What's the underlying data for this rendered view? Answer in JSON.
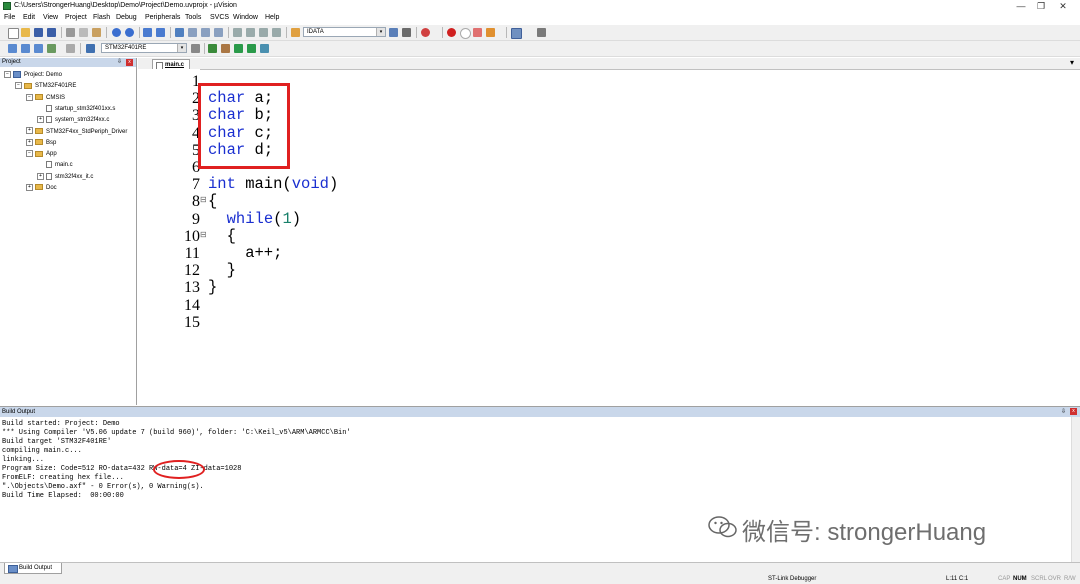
{
  "window": {
    "title": "C:\\Users\\StrongerHuang\\Desktop\\Demo\\Project\\Demo.uvprojx - µVision",
    "controls": [
      "—",
      "❐",
      "✕"
    ]
  },
  "menu": [
    "File",
    "Edit",
    "View",
    "Project",
    "Flash",
    "Debug",
    "Peripherals",
    "Tools",
    "SVCS",
    "Window",
    "Help"
  ],
  "toolbar1": {
    "search_value": "IDATA"
  },
  "toolbar2": {
    "target_value": "STM32F401RE"
  },
  "project_panel": {
    "header": "Project",
    "tree": [
      {
        "label": "Project: Demo",
        "depth": 0,
        "kind": "project",
        "toggle": "⊟"
      },
      {
        "label": "STM32F401RE",
        "depth": 1,
        "kind": "target",
        "toggle": "⊟"
      },
      {
        "label": "CMSIS",
        "depth": 2,
        "kind": "folder",
        "toggle": "⊟"
      },
      {
        "label": "startup_stm32f401xx.s",
        "depth": 3,
        "kind": "file",
        "toggle": ""
      },
      {
        "label": "system_stm32f4xx.c",
        "depth": 3,
        "kind": "file",
        "toggle": "⊞"
      },
      {
        "label": "STM32F4xx_StdPeriph_Driver",
        "depth": 2,
        "kind": "folder",
        "toggle": "⊞"
      },
      {
        "label": "Bsp",
        "depth": 2,
        "kind": "folder",
        "toggle": "⊞"
      },
      {
        "label": "App",
        "depth": 2,
        "kind": "folder",
        "toggle": "⊟"
      },
      {
        "label": "main.c",
        "depth": 3,
        "kind": "file",
        "toggle": ""
      },
      {
        "label": "stm32f4xx_it.c",
        "depth": 3,
        "kind": "file",
        "toggle": "⊞"
      },
      {
        "label": "Doc",
        "depth": 2,
        "kind": "folder",
        "toggle": "⊞"
      }
    ]
  },
  "editor": {
    "tab_label": "main.c",
    "line_numbers": [
      "1",
      "2",
      "3",
      "4",
      "5",
      "6",
      "7",
      "8",
      "9",
      "10",
      "11",
      "12",
      "13",
      "14",
      "15"
    ],
    "lines": [
      [],
      [
        {
          "t": "char",
          "c": "kw"
        },
        {
          "t": " a;",
          "c": ""
        }
      ],
      [
        {
          "t": "char",
          "c": "kw"
        },
        {
          "t": " b;",
          "c": ""
        }
      ],
      [
        {
          "t": "char",
          "c": "kw"
        },
        {
          "t": " c;",
          "c": ""
        }
      ],
      [
        {
          "t": "char",
          "c": "kw"
        },
        {
          "t": " d;",
          "c": ""
        }
      ],
      [],
      [
        {
          "t": "int",
          "c": "kw"
        },
        {
          "t": " main(",
          "c": ""
        },
        {
          "t": "void",
          "c": "kw"
        },
        {
          "t": ")",
          "c": ""
        }
      ],
      [
        {
          "t": "{",
          "c": ""
        }
      ],
      [
        {
          "t": "  ",
          "c": ""
        },
        {
          "t": "while",
          "c": "kw"
        },
        {
          "t": "(",
          "c": ""
        },
        {
          "t": "1",
          "c": "num"
        },
        {
          "t": ")",
          "c": ""
        }
      ],
      [
        {
          "t": "  {",
          "c": ""
        }
      ],
      [
        {
          "t": "    a++;",
          "c": ""
        }
      ],
      [
        {
          "t": "  }",
          "c": ""
        }
      ],
      [
        {
          "t": "}",
          "c": ""
        }
      ],
      [],
      []
    ],
    "fold_markers": [
      "⊟",
      "⊟"
    ]
  },
  "build_output": {
    "header": "Build Output",
    "lines": [
      "Build started: Project: Demo",
      "*** Using Compiler 'V5.06 update 7 (build 960)', folder: 'C:\\Keil_v5\\ARM\\ARMCC\\Bin'",
      "Build target 'STM32F401RE'",
      "compiling main.c...",
      "linking...",
      "Program Size: Code=512 RO-data=432 RW-data=4 ZI-data=1028",
      "FromELF: creating hex file...",
      "\".\\Objects\\Demo.axf\" - 0 Error(s), 0 Warning(s).",
      "Build Time Elapsed:  00:00:00"
    ]
  },
  "bottom_tab": "Build Output",
  "status_bar": {
    "debugger": "ST-Link Debugger",
    "position": "L:11 C:1",
    "caps": "CAP",
    "num": "NUM",
    "scrl": "SCRL",
    "ovr": "OVR",
    "rw": "R/W"
  },
  "watermark": {
    "text": "微信号: strongerHuang"
  },
  "colors": {
    "keyword": "#1a2fd0",
    "number": "#18806a",
    "annotation_red": "#e02020",
    "panel_header": "#c9d7ea"
  }
}
